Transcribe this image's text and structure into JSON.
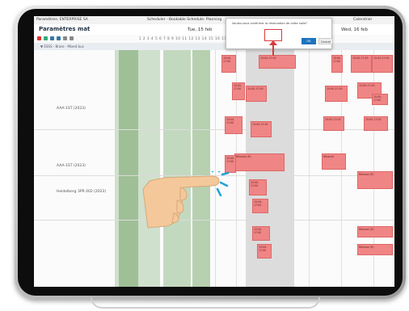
{
  "app": {
    "tab_left": "Paramètres: ENTERPRISE SA",
    "tab_mid": "Scheduler - Bookable Schedule: Planning",
    "tab_right": "Calendrier"
  },
  "header": {
    "title": "Paramètres mat",
    "date_left": "Tue, 15 feb",
    "date_right": "Wed, 16 feb"
  },
  "toolbar": {
    "hour_ticks": "1 2 3 4 5 6 7 8 9 10 11 12 13 14 15 16 17 18 19 20 21 22 23 24"
  },
  "filter": {
    "label": "▼ ESSS - Brass - Mixed bus"
  },
  "rows": [
    {
      "label": "AAA-1ST (2023)"
    },
    {
      "label": "AAA-1ST (2023)"
    },
    {
      "label": "Heidelberg 3PR 002 (2023)"
    }
  ],
  "dialog": {
    "message": "Voulez-vous confirmer la réservation de cette salle?",
    "ok_label": "OK",
    "cancel_label": "Cancel"
  },
  "booking": {
    "line1": "15:00-17:00",
    "line2": "Réunion (R)",
    "line3": "Réservé"
  },
  "colors": {
    "accent": "#1e73be",
    "booking": "#f08585",
    "highlight": "#d83a3a",
    "band_green": "#9fbf97"
  },
  "icons": [
    "hand-pointer-icon",
    "toolbar-icons"
  ]
}
